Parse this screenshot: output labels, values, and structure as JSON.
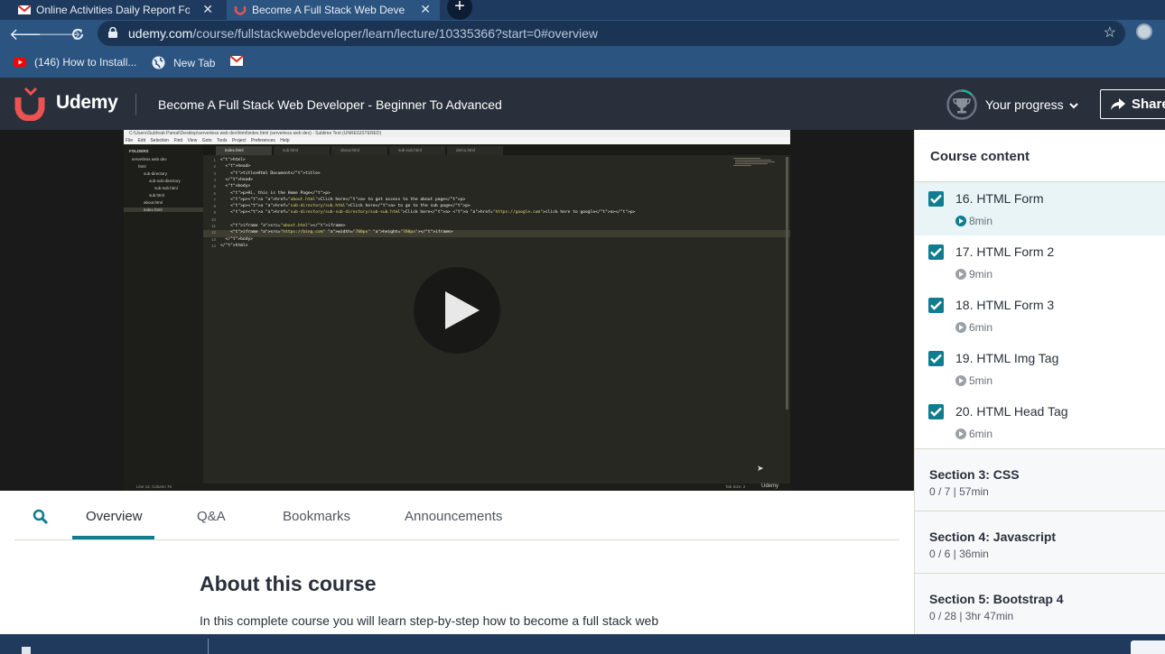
{
  "browser": {
    "tabs": [
      {
        "title": "Online Activities Daily Report For",
        "active": false
      },
      {
        "title": "Become A Full Stack Web Develop",
        "active": true
      }
    ],
    "url_domain": "udemy.com",
    "url_path": "/course/fullstackwebdeveloper/learn/lecture/10335366?start=0#overview",
    "bookmarks": [
      {
        "label": "(146) How to Install...",
        "icon": "youtube-icon"
      },
      {
        "label": "New Tab",
        "icon": "globe-icon"
      },
      {
        "label": "",
        "icon": "gmail-icon"
      }
    ]
  },
  "header": {
    "logo": "Udemy",
    "course_title": "Become A Full Stack Web Developer - Beginner To Advanced",
    "progress_label": "Your progress",
    "share_label": "Share"
  },
  "editor": {
    "titlebar": "C:\\Users\\Subhrab Pamal\\Desktop\\serverless web dev\\html\\index.html (serverless web dev) - Sublime Text (UNREGISTERED)",
    "menu": [
      "File",
      "Edit",
      "Selection",
      "Find",
      "View",
      "Goto",
      "Tools",
      "Project",
      "Preferences",
      "Help"
    ],
    "tree": [
      "FOLDERS",
      "serverless web dev",
      "html",
      "sub-directory",
      "sub-sub-directory",
      "sub-sub.html",
      "sub.html",
      "about.html",
      "index.html"
    ],
    "tabs": [
      "index.html",
      "sub.html",
      "about.html",
      "sub-sub.html",
      "demo.html"
    ],
    "lines": [
      "<html>",
      "  <head>",
      "    <title>Html Document</title>",
      "  </head>",
      "  <body>",
      "    <p>Hi, this is the Home Page</p>",
      "    <p><a href=\"about.html\">Click here</a> to get access to the about page</p>",
      "    <p><a href=\"sub-directory/sub.html\">Click here</a> to go to the sub page</p>",
      "    <p><a href=\"sub-directory/sub-sub-directory/sub-sub.html\">Click here</a> <a href=\"https://google.com\">click here to google</a></p>",
      "",
      "    <iframe src=\"about.html\"></iframe>",
      "    <iframe src=\"https://bing.com\" width=\"700px\" height=\"700px\"></iframe>",
      "  </body>",
      "</html>"
    ],
    "status_left": "Line 12, Column 76",
    "status_right": "Tab Size: 2"
  },
  "video": {
    "watermark": "Udemy"
  },
  "lower_tabs": [
    "Overview",
    "Q&A",
    "Bookmarks",
    "Announcements"
  ],
  "about": {
    "title": "About this course",
    "body": "In this complete course you will learn step-by-step how to become a full stack web"
  },
  "sidebar": {
    "title": "Course content",
    "lectures": [
      {
        "title": "16. HTML Form",
        "duration": "8min",
        "active": true
      },
      {
        "title": "17. HTML Form 2",
        "duration": "9min",
        "active": false
      },
      {
        "title": "18. HTML Form 3",
        "duration": "6min",
        "active": false
      },
      {
        "title": "19. HTML Img Tag",
        "duration": "5min",
        "active": false
      },
      {
        "title": "20. HTML Head Tag",
        "duration": "6min",
        "active": false
      }
    ],
    "sections": [
      {
        "title": "Section 3: CSS",
        "meta": "0 / 7 | 57min"
      },
      {
        "title": "Section 4: Javascript",
        "meta": "0 / 6 | 36min"
      },
      {
        "title": "Section 5: Bootstrap 4",
        "meta": "0 / 28 | 3hr 47min"
      }
    ]
  },
  "colors": {
    "brand_red": "#ec5252",
    "accent_teal": "#0f7c90",
    "header_bg": "#29303b",
    "browser_bg": "#2b5480"
  }
}
